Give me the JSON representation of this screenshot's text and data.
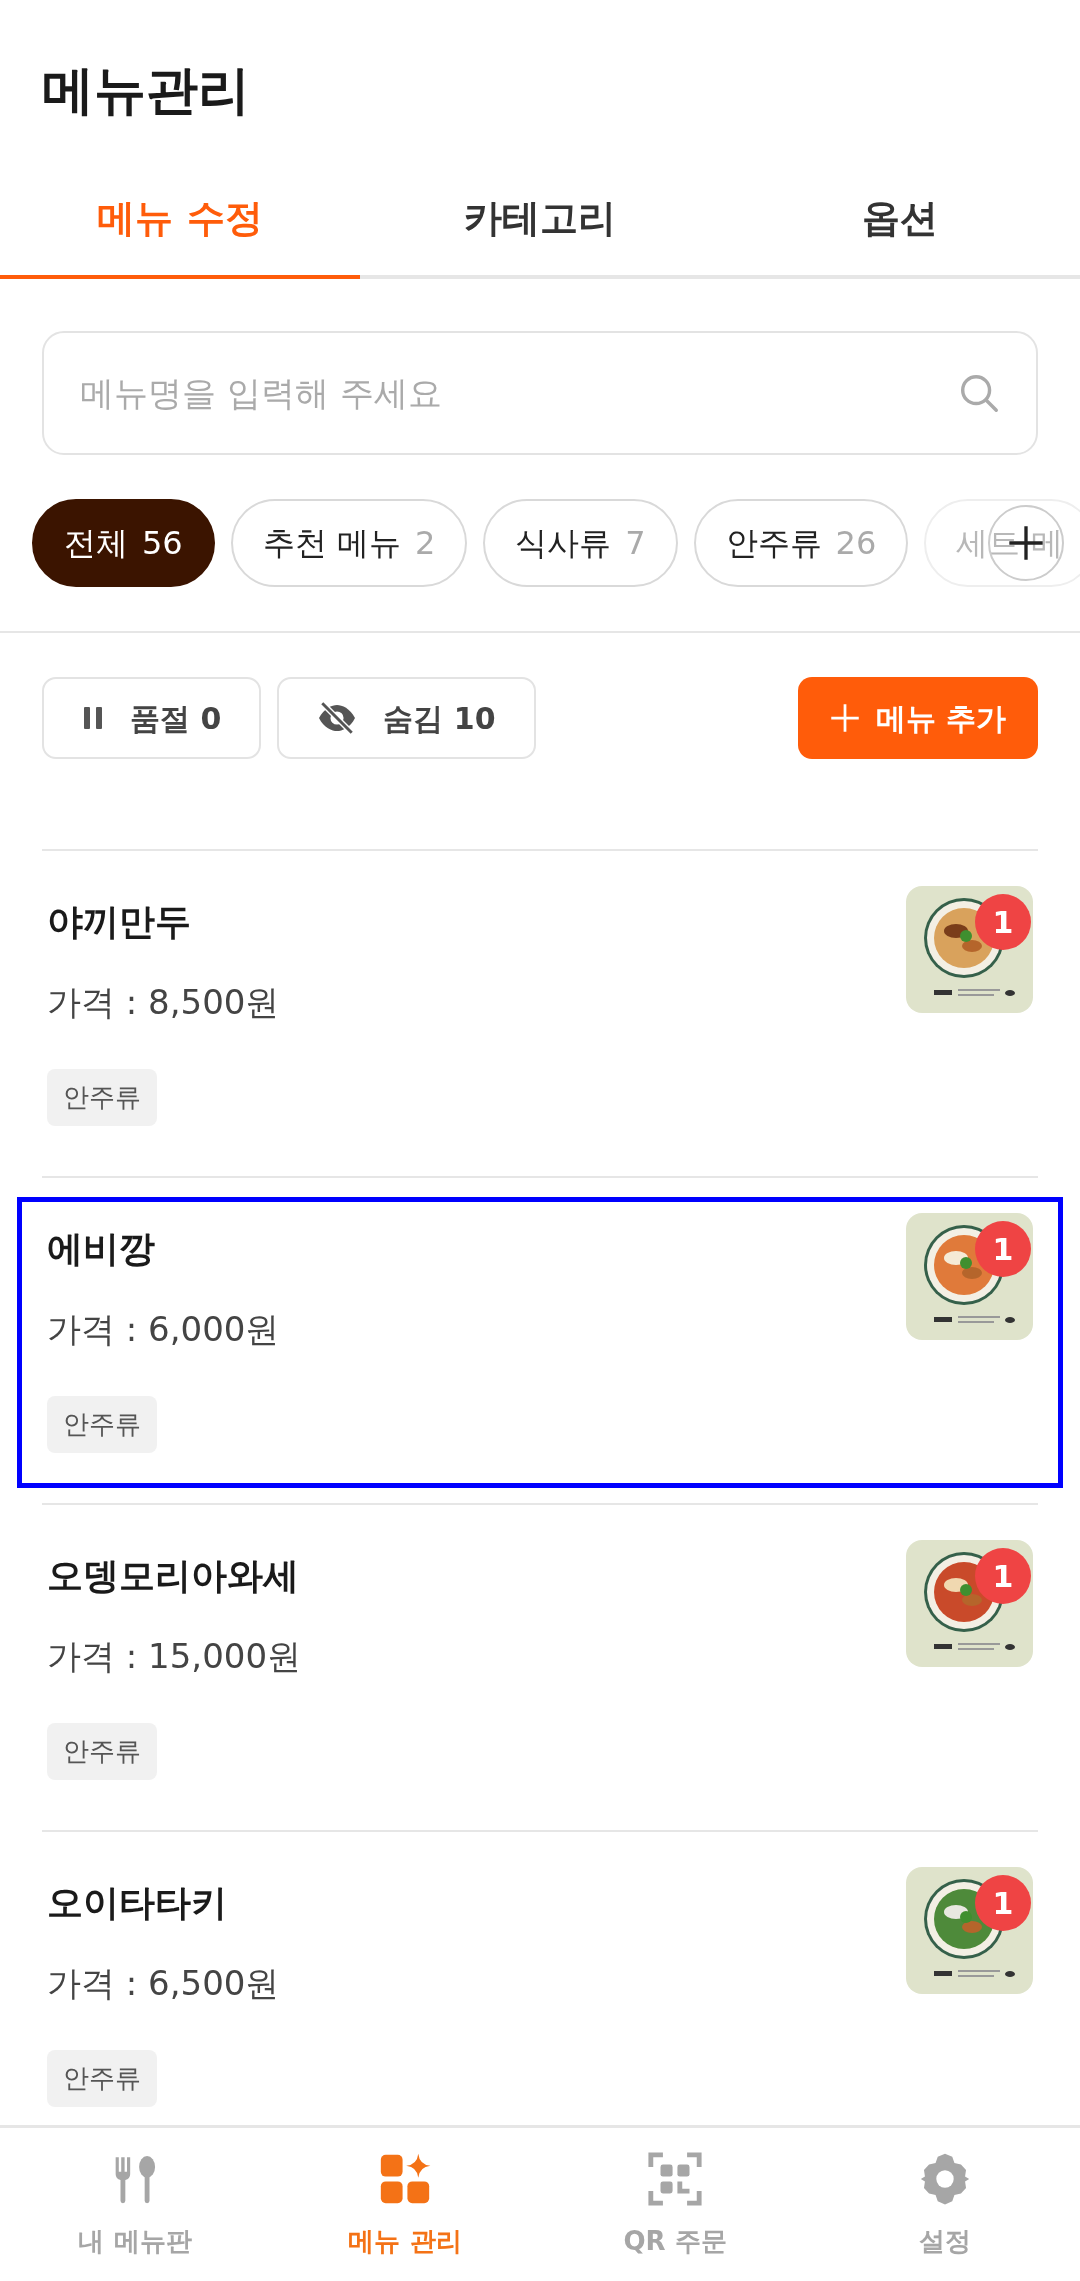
{
  "title": "메뉴관리",
  "tabs": [
    {
      "label": "메뉴 수정",
      "selected": true
    },
    {
      "label": "카테고리",
      "selected": false
    },
    {
      "label": "옵션",
      "selected": false
    }
  ],
  "search": {
    "placeholder": "메뉴명을 입력해 주세요"
  },
  "chips": [
    {
      "label": "전체",
      "count": "56",
      "selected": true
    },
    {
      "label": "추천 메뉴",
      "count": "2",
      "selected": false
    },
    {
      "label": "식사류",
      "count": "7",
      "selected": false
    },
    {
      "label": "안주류",
      "count": "26",
      "selected": false
    },
    {
      "label": "세트 메",
      "selected": false
    }
  ],
  "filters": [
    {
      "kind": "soldout",
      "label": "품절 0"
    },
    {
      "kind": "hidden",
      "label": "숨김 10"
    }
  ],
  "add_button": {
    "label": "메뉴 추가"
  },
  "items": [
    {
      "name": "야끼만두",
      "price": "가격 : 8,500원",
      "tag": "안주류",
      "badge": "1",
      "highlighted": false
    },
    {
      "name": "에비깡",
      "price": "가격 : 6,000원",
      "tag": "안주류",
      "badge": "1",
      "highlighted": true
    },
    {
      "name": "오뎅모리아와세",
      "price": "가격 : 15,000원",
      "tag": "안주류",
      "badge": "1",
      "highlighted": false
    },
    {
      "name": "오이타타키",
      "price": "가격 : 6,500원",
      "tag": "안주류",
      "badge": "1",
      "highlighted": false
    }
  ],
  "nav": [
    {
      "kind": "menuboard",
      "label": "내 메뉴판",
      "selected": false
    },
    {
      "kind": "manage",
      "label": "메뉴 관리",
      "selected": true
    },
    {
      "kind": "qr",
      "label": "QR 주문",
      "selected": false
    },
    {
      "kind": "settings",
      "label": "설정",
      "selected": false
    }
  ]
}
